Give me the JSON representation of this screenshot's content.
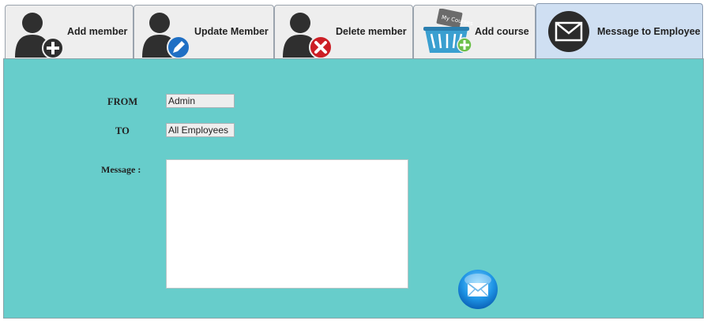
{
  "tabs": [
    {
      "label": "Add member",
      "icon": "add-member-icon"
    },
    {
      "label": "Update Member",
      "icon": "update-member-icon"
    },
    {
      "label": "Delete member",
      "icon": "delete-member-icon"
    },
    {
      "label": "Add course",
      "icon": "add-course-icon"
    },
    {
      "label": "Message to Employee",
      "icon": "mail-icon",
      "selected": true
    }
  ],
  "course_icon_text": "My Courses",
  "form": {
    "from_label": "FROM",
    "from_value": "Admin",
    "to_label": "TO",
    "to_value": "All Employees",
    "message_label": "Message :",
    "message_value": ""
  },
  "send_button": {
    "icon": "send-mail-icon"
  },
  "colors": {
    "panel_bg": "#67cdcb",
    "active_tab_bg": "#cfdff2",
    "tab_bg": "#eeeeee"
  }
}
